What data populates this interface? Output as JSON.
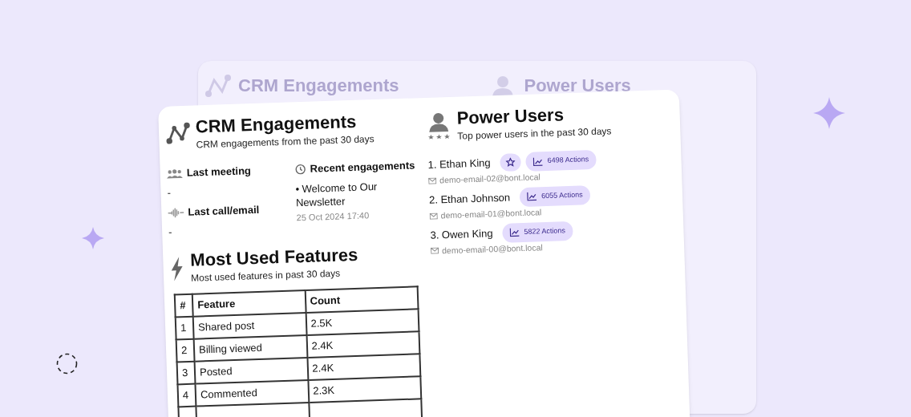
{
  "background_card": {
    "titles": [
      "CRM Engagements",
      "Power Users"
    ]
  },
  "crm": {
    "title": "CRM Engagements",
    "subtitle": "CRM engagements from the past 30 days",
    "last_meeting": {
      "label": "Last meeting",
      "value": "-"
    },
    "last_call": {
      "label": "Last call/email",
      "value": "-"
    },
    "recent": {
      "label": "Recent engagements",
      "items": [
        {
          "text": "• Welcome to Our Newsletter",
          "time": "25 Oct 2024 17:40"
        }
      ]
    }
  },
  "power_users": {
    "title": "Power Users",
    "subtitle": "Top power users in the past 30 days",
    "users": [
      {
        "name": "1. Ethan King",
        "starred": true,
        "actions": "6498 Actions",
        "email": "demo-email-02@bont.local"
      },
      {
        "name": "2. Ethan Johnson",
        "starred": false,
        "actions": "6055 Actions",
        "email": "demo-email-01@bont.local"
      },
      {
        "name": "3. Owen King",
        "starred": false,
        "actions": "5822 Actions",
        "email": "demo-email-00@bont.local"
      }
    ]
  },
  "features": {
    "title": "Most Used Features",
    "subtitle": "Most used features in past 30 days",
    "table": {
      "columns": [
        "#",
        "Feature",
        "Count"
      ],
      "rows": [
        [
          "1",
          "Shared post",
          "2.5K"
        ],
        [
          "2",
          "Billing viewed",
          "2.4K"
        ],
        [
          "3",
          "Posted",
          "2.4K"
        ],
        [
          "4",
          "Commented",
          "2.3K"
        ]
      ]
    }
  }
}
